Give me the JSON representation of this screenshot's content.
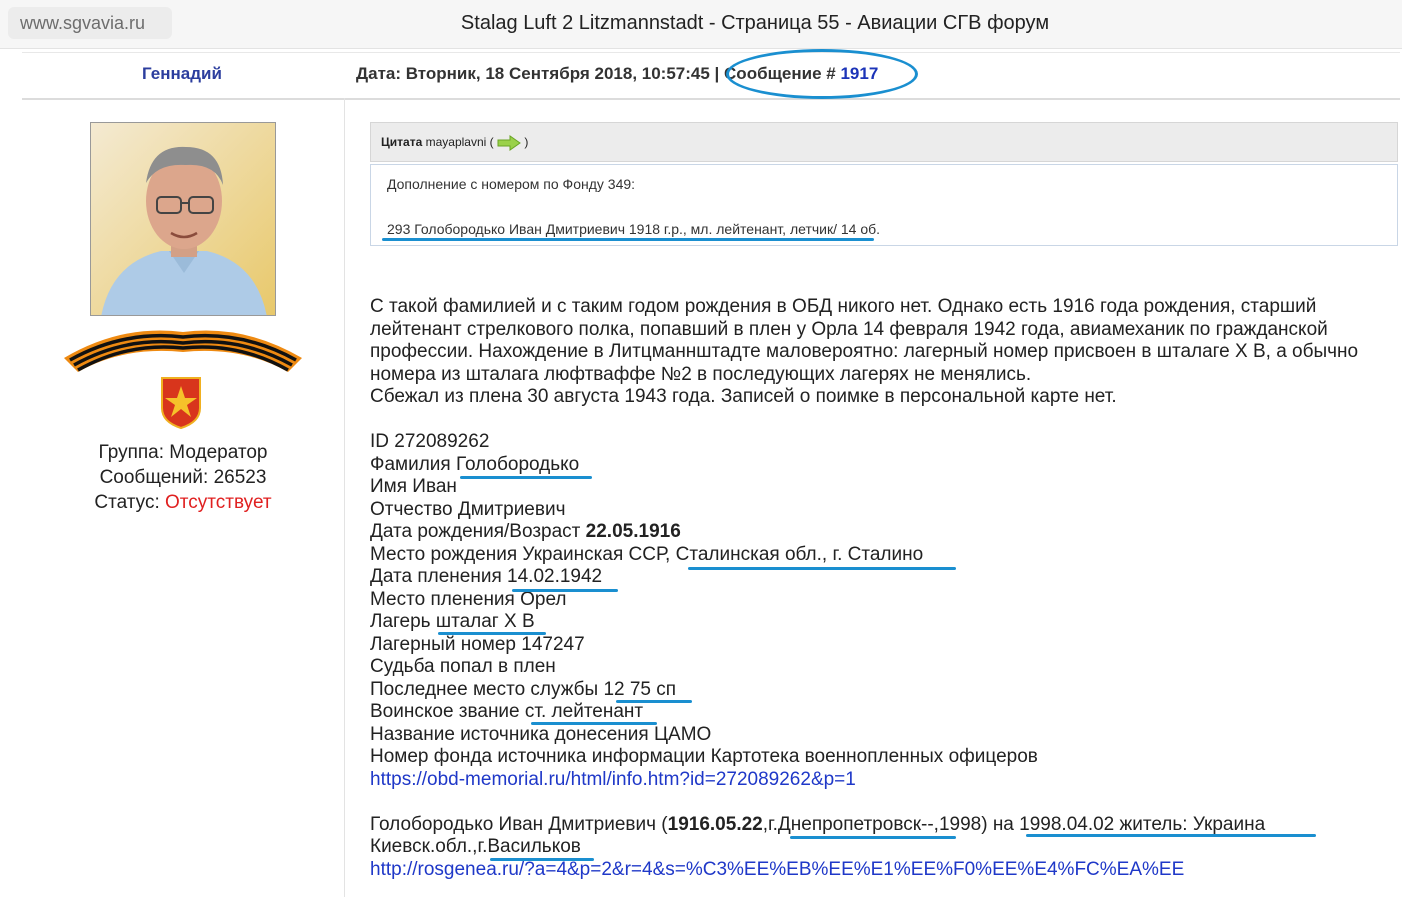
{
  "browser": {
    "url": "www.sgvavia.ru",
    "title": "Stalag Luft 2 Litzmannstadt - Страница 55 - Авиации СГВ форум"
  },
  "post": {
    "author": "Геннадий",
    "date_label": "Дата: Вторник, 18 Сентября 2018, 10:57:45 | ",
    "msg_label": "Сообщение # ",
    "msg_number": "1917"
  },
  "user": {
    "group": "Группа: Модератор",
    "messages": "Сообщений: 26523",
    "status_label": "Статус: ",
    "status_value": "Отсутствует"
  },
  "quote": {
    "label": "Цитата",
    "author": "mayaplavni (",
    "close": ")",
    "line1": "Дополнение с номером по Фонду 349:",
    "line2": "293 Голобородько Иван Дмитриевич 1918 г.р., мл. лейтенант, летчик/ 14 об."
  },
  "body": {
    "para1": "С такой фамилией и с таким годом рождения в ОБД никого нет. Однако есть 1916 года рождения, старший лейтенант стрелкового полка, попавший в плен у Орла 14 февраля 1942 года, авиамеханик по гражданской профессии. Нахождение в Литцманнштадте маловероятно: лагерный номер присвоен в шталаге Х В, а обычно номера из шталага люфтваффе №2 в последующих лагерях не менялись.",
    "para2": "Сбежал из плена 30 августа 1943 года. Записей о поимке в персональной карте нет.",
    "id_line": "ID 272089262",
    "surname": "Фамилия Голобородько",
    "name": "Имя Иван",
    "patronymic": "Отчество Дмитриевич",
    "dob_label": "Дата рождения/Возраст ",
    "dob_value": "22.05.1916",
    "birthplace": "Место рождения Украинская ССР, Сталинская обл., г. Сталино",
    "capture_date": "Дата пленения 14.02.1942",
    "capture_place": "Место пленения Орел",
    "camp": "Лагерь шталаг Х В",
    "camp_number": "Лагерный номер 147247",
    "fate": "Судьба попал в плен",
    "last_service": "Последнее место службы 12 75 сп",
    "rank": "Воинское звание ст. лейтенант",
    "source": "Название источника донесения ЦАМО",
    "fund": "Номер фонда источника информации Картотека военнопленных офицеров",
    "link1": "https://obd-memorial.ru/html/info.htm?id=272089262&p=1",
    "g_name": "Голобородько Иван Дмитриевич (",
    "g_date": "1916.05.22",
    "g_rest": ",г.Днепропетровск--,1998) на 1998.04.02 житель: Украина",
    "g_line2": "Киевск.обл.,г.Васильков",
    "link2": "http://rosgenea.ru/?a=4&p=2&r=4&s=%C3%EE%EB%EE%E1%EE%F0%EE%E4%FC%EA%EE"
  }
}
